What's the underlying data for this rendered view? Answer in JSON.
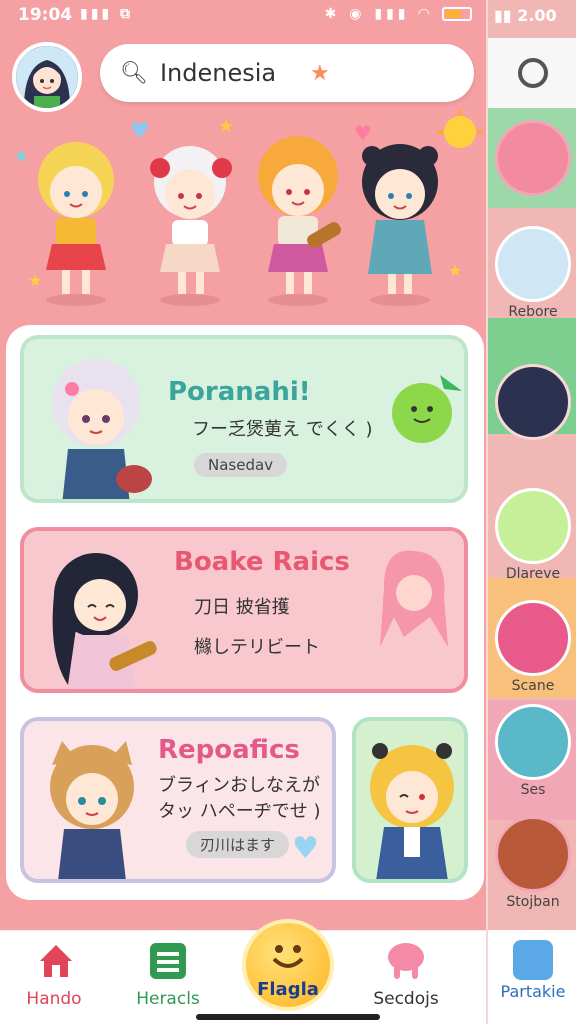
{
  "status": {
    "time": "19:04",
    "side_time": "2.00"
  },
  "search": {
    "value": "Indenesia",
    "icon": "search-icon"
  },
  "cards": [
    {
      "title": "Poranahi!",
      "subtitle": "フー乏煲莄え でくく )",
      "badge": "Nasedav",
      "title_color": "#3aa59a"
    },
    {
      "title": "Boake Raics",
      "line1": "刀日 披省擭",
      "line2": "櫞しテリビート",
      "title_color": "#e85870"
    },
    {
      "title": "Repoafics",
      "line1": "ブラィンおしなえが",
      "line2": "タッ ハペーヂでせ )",
      "badge": "刃川はます",
      "title_color": "#e35a8a"
    }
  ],
  "nav": {
    "items": [
      {
        "label": "Hando",
        "color": "#e0455a"
      },
      {
        "label": "Heracls",
        "color": "#2f9a50"
      },
      {
        "label": "Flagla",
        "color": "#1a3d8c"
      },
      {
        "label": "Secdojs",
        "color": "#333333"
      },
      {
        "label": "Partakie",
        "color": "#2a6fbf"
      }
    ]
  },
  "side": {
    "items": [
      {
        "label": "Rebore"
      },
      {
        "label": "Dlareve"
      },
      {
        "label": "Scane"
      },
      {
        "label": "Ses"
      },
      {
        "label": "Stojban"
      }
    ]
  }
}
